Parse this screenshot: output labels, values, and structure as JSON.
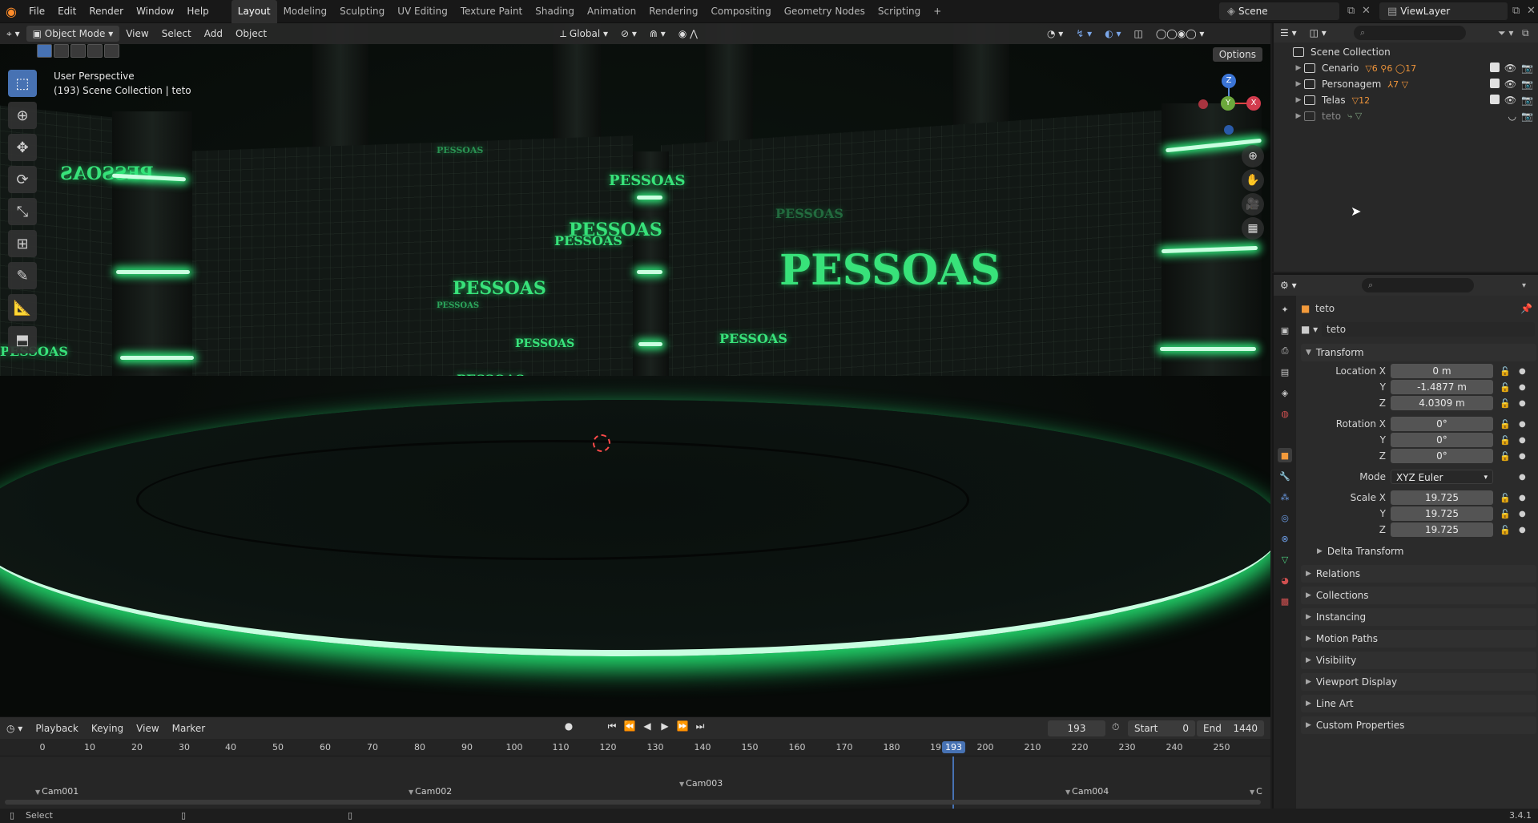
{
  "menubar": {
    "items": [
      "File",
      "Edit",
      "Render",
      "Window",
      "Help"
    ],
    "workspaces": [
      "Layout",
      "Modeling",
      "Sculpting",
      "UV Editing",
      "Texture Paint",
      "Shading",
      "Animation",
      "Rendering",
      "Compositing",
      "Geometry Nodes",
      "Scripting"
    ],
    "active_workspace": "Layout",
    "add_tab": "+",
    "scene": "Scene",
    "view_layer": "ViewLayer"
  },
  "viewport": {
    "header": {
      "mode": "Object Mode",
      "menus": [
        "View",
        "Select",
        "Add",
        "Object"
      ],
      "orientation": "Global"
    },
    "options_label": "Options",
    "overlay_line1": "User Perspective",
    "overlay_line2": "(193) Scene Collection | teto",
    "gizmo_axes": {
      "x": "X",
      "y": "Y",
      "z": "Z"
    },
    "scene_texts": [
      "PESSOAS"
    ]
  },
  "timeline": {
    "menus": [
      "Playback",
      "Keying",
      "View",
      "Marker"
    ],
    "current_frame": "193",
    "start_label": "Start",
    "start_value": "0",
    "end_label": "End",
    "end_value": "1440",
    "ticks": [
      "0",
      "10",
      "20",
      "30",
      "40",
      "50",
      "60",
      "70",
      "80",
      "90",
      "100",
      "110",
      "120",
      "130",
      "140",
      "150",
      "160",
      "170",
      "180",
      "19",
      "200",
      "210",
      "220",
      "230",
      "240",
      "250"
    ],
    "markers": [
      "Cam001",
      "Cam002",
      "Cam003",
      "Cam004",
      "C"
    ]
  },
  "outliner": {
    "root": "Scene Collection",
    "rows": [
      {
        "name": "Cenario",
        "badges": "▽6 ⚲6 ◯17"
      },
      {
        "name": "Personagem",
        "badges": "⅄7 ▽"
      },
      {
        "name": "Telas",
        "badges": "▽12"
      },
      {
        "name": "teto",
        "badges": "⤷ ▽"
      }
    ]
  },
  "properties": {
    "object_name": "teto",
    "datablock_name": "teto",
    "transform_title": "Transform",
    "location": {
      "label": "Location X",
      "x": "0 m",
      "y": "-1.4877 m",
      "z": "4.0309 m"
    },
    "rotation": {
      "label": "Rotation X",
      "x": "0°",
      "y": "0°",
      "z": "0°"
    },
    "mode_label": "Mode",
    "mode_value": "XYZ Euler",
    "scale": {
      "label": "Scale X",
      "x": "19.725",
      "y": "19.725",
      "z": "19.725"
    },
    "axis_y": "Y",
    "axis_z": "Z",
    "delta_transform": "Delta Transform",
    "panels": [
      "Relations",
      "Collections",
      "Instancing",
      "Motion Paths",
      "Visibility",
      "Viewport Display",
      "Line Art",
      "Custom Properties"
    ]
  },
  "statusbar": {
    "left": "Select",
    "version": "3.4.1"
  },
  "colors": {
    "accent": "#4772b3",
    "neon_green": "#38e27a",
    "object_orange": "#f39a3b"
  }
}
